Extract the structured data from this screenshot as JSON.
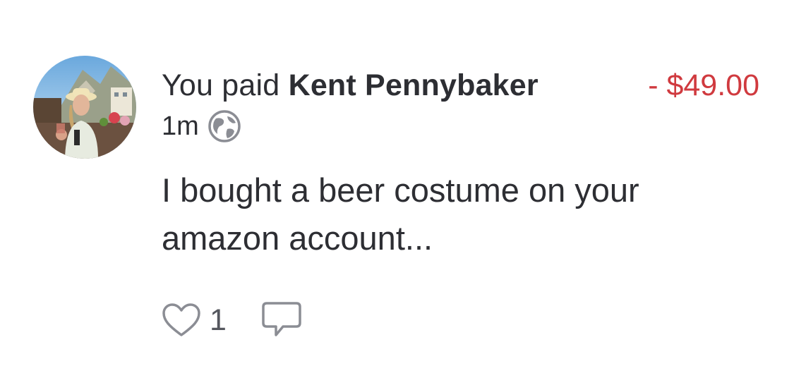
{
  "story": {
    "actor": "You paid",
    "target": "Kent Pennybaker",
    "amount": "- $49.00",
    "time": "1m",
    "audience_icon": "globe-icon",
    "note": "I bought a beer costume on your amazon account...",
    "likes": "1",
    "like_icon": "heart-icon",
    "comment_icon": "comment-bubble-icon"
  },
  "colors": {
    "text": "#2d2e33",
    "amount_negative": "#d03a3f",
    "icon": "#8b8d94"
  }
}
